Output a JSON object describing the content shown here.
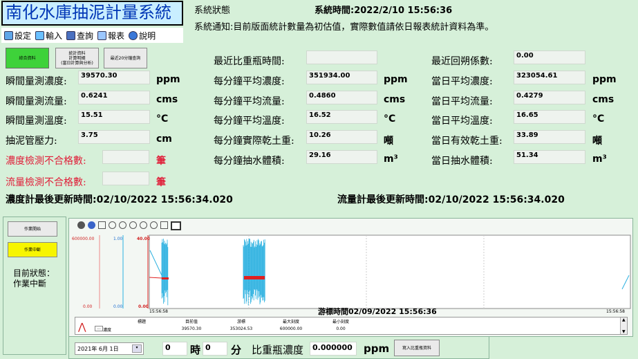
{
  "app": {
    "title": "南化水庫抽泥計量系統"
  },
  "menu": {
    "items": [
      "設定",
      "輸入",
      "查詢",
      "報表",
      "說明"
    ]
  },
  "status": {
    "state_label": "系統狀態",
    "time_label": "系統時間:2022/2/10 15:56:36",
    "notice": "系統通知:目前版面統計數量為初估值，實際數值請依日報表統計資料為準。"
  },
  "buttons": {
    "overview": "綜合資料",
    "stats_line1": "統計資料",
    "stats_line2": "計算明細",
    "stats_line3": "(當日計算與分析)",
    "last20": "最近20分鐘查詢",
    "start": "作業開始",
    "stop": "作業中斷",
    "import": "寫入比重瓶資料"
  },
  "instant": {
    "conc_label": "瞬間量測濃度:",
    "conc_value": "39570.30",
    "conc_unit": "ppm",
    "flow_label": "瞬間量測流量:",
    "flow_value": "0.6241",
    "flow_unit": "cms",
    "temp_label": "瞬間量測溫度:",
    "temp_value": "15.51",
    "temp_unit": "°C",
    "press_label": "抽泥管壓力:",
    "press_value": "3.75",
    "press_unit": "cm",
    "conc_fail_label": "濃度檢測不合格數:",
    "conc_fail_unit": "筆",
    "flow_fail_label": "流量檢測不合格數:",
    "flow_fail_unit": "筆"
  },
  "minute": {
    "bottle_label": "最近比重瓶時間:",
    "conc_label": "每分鐘平均濃度:",
    "conc_value": "351934.00",
    "conc_unit": "ppm",
    "flow_label": "每分鐘平均流量:",
    "flow_value": "0.4860",
    "flow_unit": "cms",
    "temp_label": "每分鐘平均溫度:",
    "temp_value": "16.52",
    "temp_unit": "°C",
    "dry_label": "每分鐘實際乾土重:",
    "dry_value": "10.26",
    "dry_unit": "噸",
    "vol_label": "每分鐘抽水體積:",
    "vol_value": "29.16",
    "vol_unit": "m³"
  },
  "daily": {
    "reg_label": "最近回朔係數:",
    "reg_value": "0.00",
    "conc_label": "當日平均濃度:",
    "conc_value": "323054.61",
    "conc_unit": "ppm",
    "flow_label": "當日平均流量:",
    "flow_value": "0.4279",
    "flow_unit": "cms",
    "temp_label": "當日平均溫度:",
    "temp_value": "16.65",
    "temp_unit": "°C",
    "dry_label": "當日有效乾土重:",
    "dry_value": "33.89",
    "dry_unit": "噸",
    "vol_label": "當日抽水體積:",
    "vol_value": "51.34",
    "vol_unit": "m³"
  },
  "updates": {
    "conc": "濃度計最後更新時間:02/10/2022 15:56:34.020",
    "flow": "流量計最後更新時間:02/10/2022 15:56:34.020"
  },
  "panel": {
    "state_line1": "目前狀態：",
    "state_line2": "作業中斷"
  },
  "chart": {
    "axis1_top": "600000.00",
    "axis1_bottom": "0.00",
    "axis2_top": "1.00",
    "axis2_bottom": "0.00",
    "axis3_top": "40.00",
    "axis3_bottom": "0.00",
    "time_left": "15:56:58",
    "time_right": "15:56:58",
    "cursor_time": "游標時間02/09/2022 15:56:36",
    "colors": {
      "conc": "#2ab0e0",
      "flow": "#1f6fd0",
      "temp": "#e02020"
    }
  },
  "grid_table": {
    "headers": [
      "標題",
      "目前值",
      "游標",
      "最大刻度",
      "最小刻度"
    ],
    "row": [
      "濃度",
      "39570.30",
      "353024.53",
      "600000.00",
      "0.00"
    ]
  },
  "bottom": {
    "date": "2021年 6月 1日",
    "hour_value": "0",
    "hour_label": "時",
    "min_value": "0",
    "min_label": "分",
    "bottle_label": "比重瓶濃度",
    "bottle_value": "0.000000",
    "bottle_unit": "ppm"
  }
}
